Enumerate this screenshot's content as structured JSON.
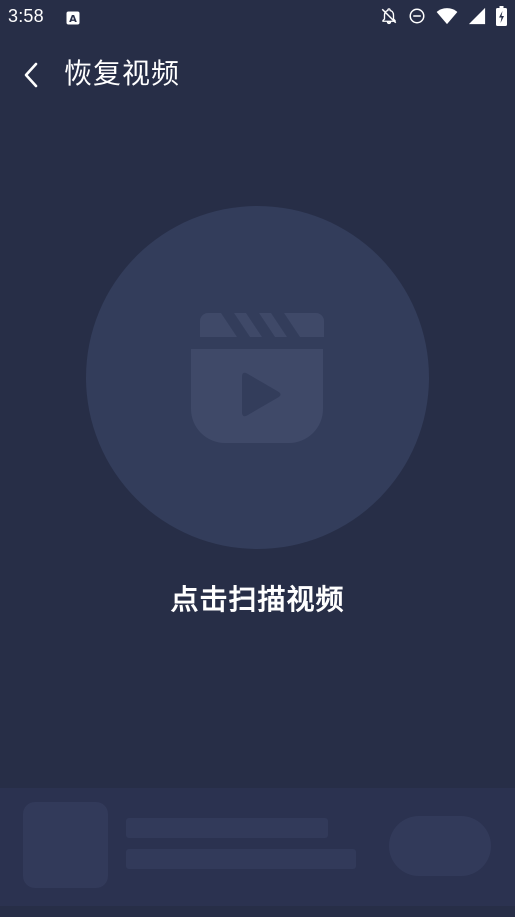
{
  "status_bar": {
    "time": "3:58",
    "icons": [
      "font-app-icon",
      "notifications-off-icon",
      "do-not-disturb-icon",
      "wifi-icon",
      "cellular-signal-icon",
      "battery-charging-icon"
    ]
  },
  "app_bar": {
    "back_icon": "chevron-left-icon",
    "title": "恢复视频"
  },
  "main": {
    "icon": "video-clapper-play-icon",
    "scan_label": "点击扫描视频"
  },
  "colors": {
    "background": "#272e47",
    "circle": "#333d5b",
    "icon": "#3f4968",
    "text": "#ffffff",
    "placeholder": "#323a5a"
  }
}
